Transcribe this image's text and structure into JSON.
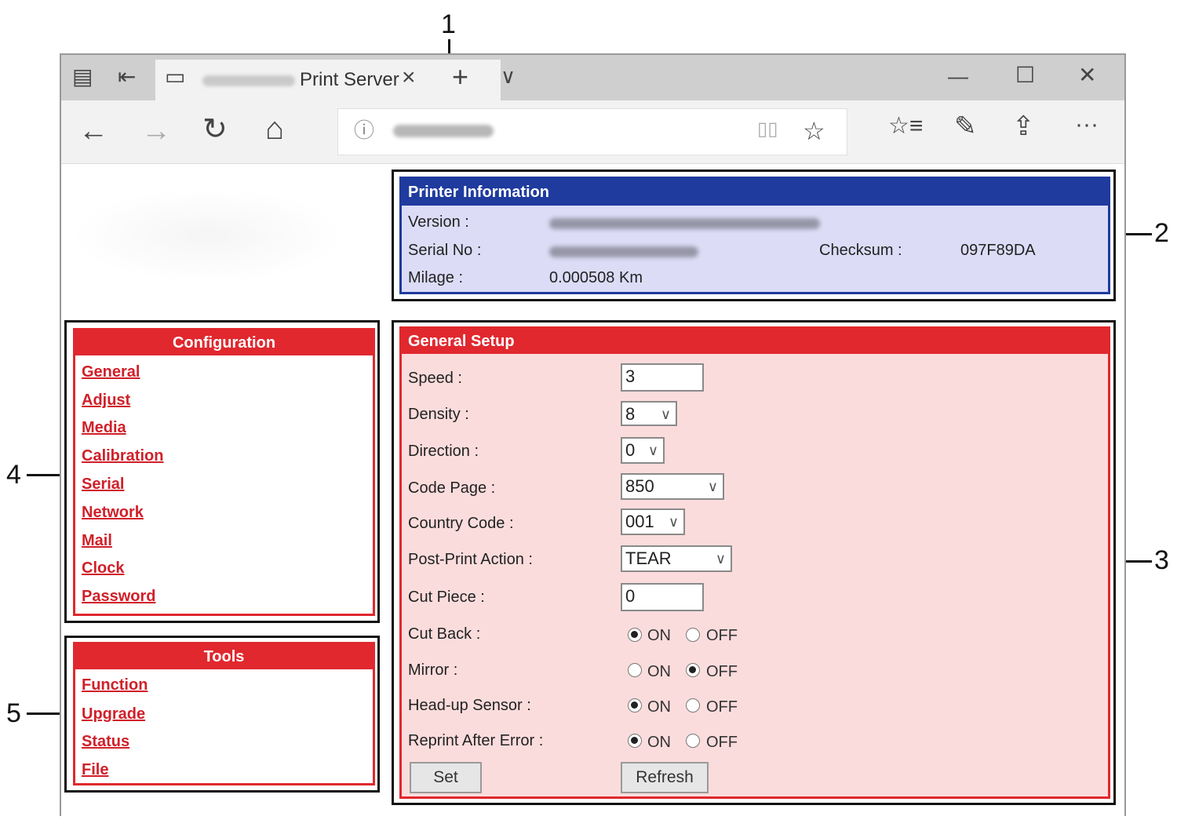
{
  "callouts": [
    "1",
    "2",
    "3",
    "4",
    "5"
  ],
  "browser": {
    "tab_title": "Print Server",
    "tab_close": "×",
    "new_tab": "+",
    "tab_list": "∨",
    "window_minimize": "—",
    "window_maximize": "☐",
    "window_close": "✕",
    "back": "←",
    "forward": "→",
    "refresh": "↻",
    "home": "⌂",
    "info": "ⓘ",
    "reading_view": "▯▯",
    "favorite": "☆",
    "favorites_list": "☆≡",
    "notes": "✎",
    "share": "⇪",
    "more": "···"
  },
  "printer_info": {
    "header": "Printer Information",
    "version_label": "Version :",
    "serial_label": "Serial No :",
    "checksum_label": "Checksum :",
    "checksum_value": "097F89DA",
    "milage_label": "Milage :",
    "milage_value": "0.000508 Km"
  },
  "configuration": {
    "header": "Configuration",
    "links": [
      "General",
      "Adjust",
      "Media",
      "Calibration",
      "Serial",
      "Network",
      "Mail",
      "Clock",
      "Password"
    ]
  },
  "tools": {
    "header": "Tools",
    "links": [
      "Function",
      "Upgrade",
      "Status",
      "File"
    ]
  },
  "general_setup": {
    "header": "General Setup",
    "speed_label": "Speed :",
    "speed_value": "3",
    "density_label": "Density :",
    "density_value": "8",
    "direction_label": "Direction :",
    "direction_value": "0",
    "code_page_label": "Code Page :",
    "code_page_value": "850",
    "country_code_label": "Country Code :",
    "country_code_value": "001",
    "post_print_label": "Post-Print Action :",
    "post_print_value": "TEAR",
    "cut_piece_label": "Cut Piece :",
    "cut_piece_value": "0",
    "cut_back_label": "Cut Back :",
    "mirror_label": "Mirror :",
    "headup_label": "Head-up Sensor :",
    "reprint_label": "Reprint After Error :",
    "on_label": "ON",
    "off_label": "OFF",
    "cut_back": "ON",
    "mirror": "OFF",
    "headup_sensor": "ON",
    "reprint_after_error": "ON",
    "set_button": "Set",
    "refresh_button": "Refresh"
  }
}
